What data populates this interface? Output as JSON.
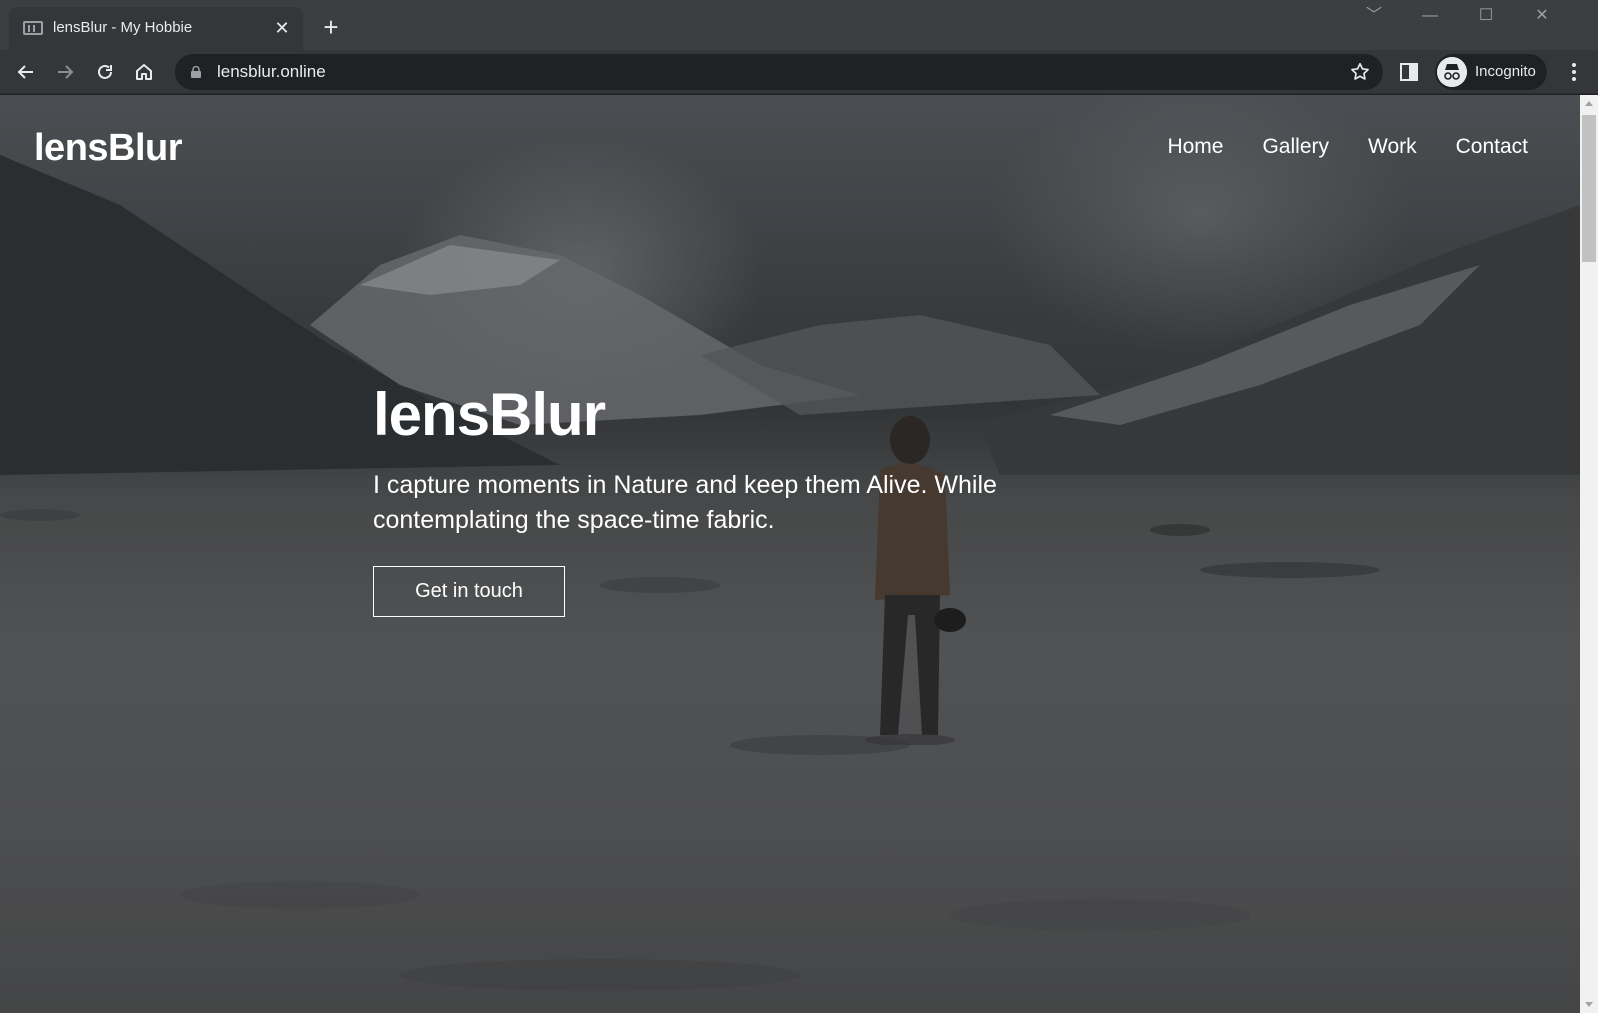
{
  "browser": {
    "tab_title": "lensBlur - My Hobbie",
    "url": "lensblur.online",
    "profile_label": "Incognito",
    "tab_close_glyph": "✕",
    "new_tab_glyph": "+",
    "window_controls": [
      "﹀",
      "—",
      "☐",
      "✕"
    ]
  },
  "site": {
    "logo": "lensBlur",
    "nav": [
      "Home",
      "Gallery",
      "Work",
      "Contact"
    ],
    "hero_title": "lensBlur",
    "hero_text": "I capture moments in Nature and keep them Alive. While contemplating the space-time fabric.",
    "cta_label": "Get in touch"
  },
  "icons": {
    "back": "back-arrow-icon",
    "forward": "forward-arrow-icon",
    "reload": "reload-icon",
    "home": "home-icon",
    "lock": "lock-icon",
    "star": "bookmark-star-icon",
    "side_panel": "side-panel-icon",
    "incognito": "incognito-icon",
    "menu": "kebab-menu-icon"
  },
  "colors": {
    "chrome_dark": "#35363a",
    "omnibox": "#202124",
    "text_light": "#e8eaed"
  }
}
